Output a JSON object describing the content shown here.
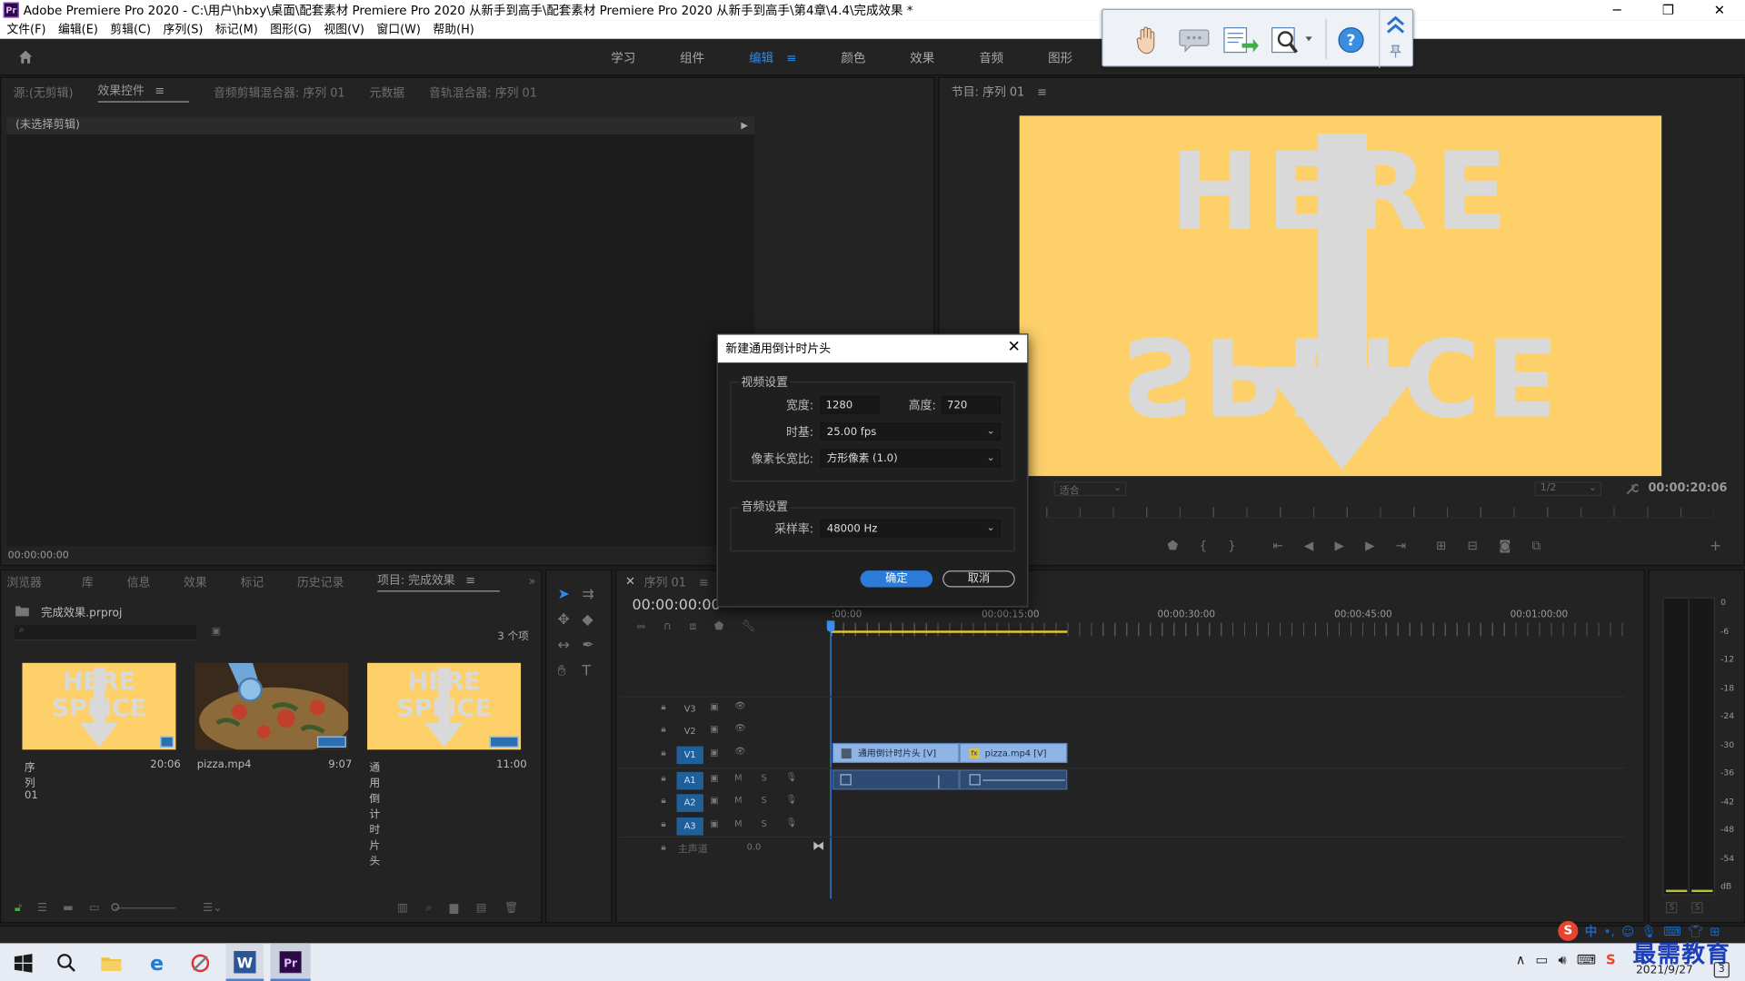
{
  "window": {
    "title": "Adobe Premiere Pro 2020 - C:\\用户\\hbxy\\桌面\\配套素材 Premiere Pro 2020 从新手到高手\\配套素材 Premiere Pro 2020 从新手到高手\\第4章\\4.4\\完成效果 *",
    "pr_logo": "Pr"
  },
  "menu": [
    "文件(F)",
    "编辑(E)",
    "剪辑(C)",
    "序列(S)",
    "标记(M)",
    "图形(G)",
    "视图(V)",
    "窗口(W)",
    "帮助(H)"
  ],
  "workspaces": {
    "items": [
      "学习",
      "组件",
      "编辑",
      "颜色",
      "效果",
      "音频",
      "图形",
      "库"
    ],
    "active": "编辑"
  },
  "source_panel": {
    "tabs": [
      "源:(无剪辑)",
      "效果控件",
      "音频剪辑混合器: 序列 01",
      "元数据",
      "音轨混合器: 序列 01"
    ],
    "active_tab": "效果控件",
    "no_clip": "(未选择剪辑)",
    "timecode": "00:00:00:00"
  },
  "program_panel": {
    "title": "节目: 序列 01",
    "frame_text_top": "HERE",
    "frame_text_bottom": "SPLICE",
    "fit": "适合",
    "scale": "1/2",
    "timecode": "00:00:20:06"
  },
  "project_panel": {
    "tabs": [
      "浏览器",
      "库",
      "信息",
      "效果",
      "标记",
      "历史记录",
      "项目: 完成效果"
    ],
    "active_tab": "项目: 完成效果",
    "file": "完成效果.prproj",
    "count": "3 个项",
    "items": [
      {
        "name": "序列 01",
        "duration": "20:06"
      },
      {
        "name": "pizza.mp4",
        "duration": "9:07"
      },
      {
        "name": "通用倒计时片头",
        "duration": "11:00"
      }
    ]
  },
  "timeline": {
    "tab": "序列 01",
    "timecode": "00:00:00:00",
    "ruler": [
      ":00:00",
      "00:00:15:00",
      "00:00:30:00",
      "00:00:45:00",
      "00:01:00:00"
    ],
    "video_tracks": [
      "V3",
      "V2",
      "V1"
    ],
    "audio_tracks": [
      "A1",
      "A2",
      "A3"
    ],
    "master": "主声道",
    "master_value": "0.0",
    "clips": {
      "v1_a": "通用倒计时片头 [V]",
      "v1_b": "pizza.mp4 [V]"
    },
    "mute": "M",
    "solo": "S"
  },
  "meter": {
    "labels": [
      "0",
      "-6",
      "-12",
      "-18",
      "-24",
      "-30",
      "-36",
      "-42",
      "-48",
      "-54",
      "dB"
    ],
    "solo": [
      "S",
      "S"
    ]
  },
  "dialog": {
    "title": "新建通用倒计时片头",
    "video_group": "视频设置",
    "width_label": "宽度:",
    "width": "1280",
    "height_label": "高度:",
    "height": "720",
    "timebase_label": "时基:",
    "timebase": "25.00 fps",
    "par_label": "像素长宽比:",
    "par": "方形像素 (1.0)",
    "audio_group": "音频设置",
    "rate_label": "采样率:",
    "rate": "48000 Hz",
    "ok": "确定",
    "cancel": "取消"
  },
  "taskbar": {
    "date": "2021/9/27",
    "ime": "中",
    "brand": "最需教育",
    "notif": "3"
  },
  "colors": {
    "accent": "#2d8ceb",
    "frame_bg": "#fdd06a",
    "clip_video": "#8fb4e6",
    "clip_audio": "#2f4a73"
  }
}
